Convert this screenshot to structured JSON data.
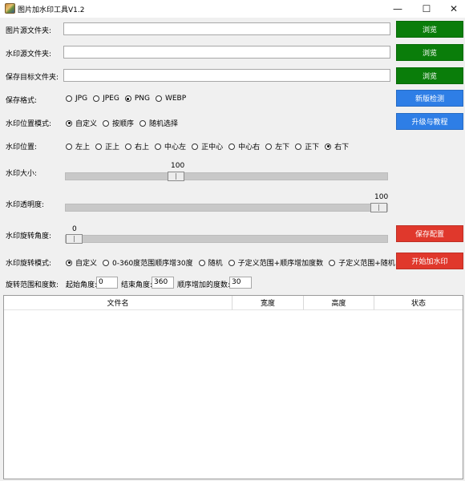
{
  "window": {
    "title": "图片加水印工具V1.2",
    "controls": {
      "minimize": "—",
      "maximize": "☐",
      "close": "✕"
    }
  },
  "folders": {
    "source_label": "图片源文件夹:",
    "source_value": "",
    "watermark_label": "水印源文件夹:",
    "watermark_value": "",
    "target_label": "保存目标文件夹:",
    "target_value": "",
    "browse_label": "浏览"
  },
  "format": {
    "label": "保存格式:",
    "options": [
      "JPG",
      "JPEG",
      "PNG",
      "WEBP"
    ],
    "selected": "PNG"
  },
  "position_mode": {
    "label": "水印位置模式:",
    "options": [
      "自定义",
      "按顺序",
      "随机选择"
    ],
    "selected": "自定义"
  },
  "position": {
    "label": "水印位置:",
    "options": [
      "左上",
      "正上",
      "右上",
      "中心左",
      "正中心",
      "中心右",
      "左下",
      "正下",
      "右下"
    ],
    "selected": "右下"
  },
  "size": {
    "label": "水印大小:",
    "value": "100",
    "level_fraction": 0.35
  },
  "opacity": {
    "label": "水印透明度:",
    "value": "100",
    "level_fraction": 1.0
  },
  "rotation_angle": {
    "label": "水印旋转角度:",
    "value": "0",
    "level_fraction": 0.0
  },
  "rotation_mode": {
    "label": "水印旋转模式:",
    "options": [
      "自定义",
      "0-360度范围顺序增30度",
      "随机",
      "子定义范围+顺序增加度数",
      "子定义范围+随机"
    ],
    "selected": "自定义"
  },
  "rotation_range": {
    "label": "旋转范围和度数:",
    "start_label": "起始角度:",
    "start_value": "0",
    "end_label": "结束角度:",
    "end_value": "360",
    "step_label": "顺序增加的度数:",
    "step_value": "30"
  },
  "buttons": {
    "check_version": "新版检测",
    "upgrade": "升级与教程",
    "save_config": "保存配置",
    "start": "开始加水印"
  },
  "colors": {
    "green": "#0a7d0a",
    "blue": "#2e7ee6",
    "red": "#e0382c"
  },
  "table": {
    "columns": [
      "文件名",
      "宽度",
      "高度",
      "状态"
    ],
    "rows": []
  }
}
